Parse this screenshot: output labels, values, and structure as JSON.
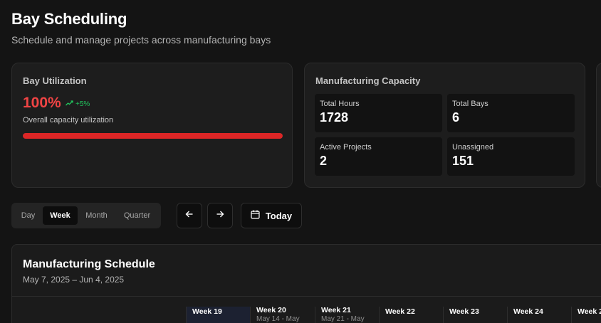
{
  "header": {
    "title": "Bay Scheduling",
    "subtitle": "Schedule and manage projects across manufacturing bays"
  },
  "utilization": {
    "title": "Bay Utilization",
    "value": "100%",
    "fill_fraction": 1.0,
    "trend": "+5%",
    "trend_icon": "trending-up-icon",
    "caption": "Overall capacity utilization",
    "colors": {
      "value": "#ef4444",
      "bar": "#dc2626",
      "trend": "#22c55e"
    }
  },
  "capacity": {
    "title": "Manufacturing Capacity",
    "stats": [
      {
        "label": "Total Hours",
        "value": "1728"
      },
      {
        "label": "Total Bays",
        "value": "6"
      },
      {
        "label": "Active Projects",
        "value": "2"
      },
      {
        "label": "Unassigned",
        "value": "151"
      }
    ]
  },
  "controls": {
    "views": [
      "Day",
      "Week",
      "Month",
      "Quarter"
    ],
    "active_view": "Week",
    "prev_icon": "arrow-left-icon",
    "next_icon": "arrow-right-icon",
    "today_icon": "calendar-icon",
    "today_label": "Today"
  },
  "schedule": {
    "title": "Manufacturing Schedule",
    "range": "May 7, 2025 – Jun 4, 2025",
    "weeks": [
      {
        "label": "Week 19",
        "dates": "",
        "current": true
      },
      {
        "label": "Week 20",
        "dates": "May 14 - May",
        "current": false
      },
      {
        "label": "Week 21",
        "dates": "May 21 - May",
        "current": false
      },
      {
        "label": "Week 22",
        "dates": "",
        "current": false
      },
      {
        "label": "Week 23",
        "dates": "",
        "current": false
      },
      {
        "label": "Week 24",
        "dates": "",
        "current": false
      },
      {
        "label": "Week 2",
        "dates": "",
        "current": false
      }
    ]
  }
}
